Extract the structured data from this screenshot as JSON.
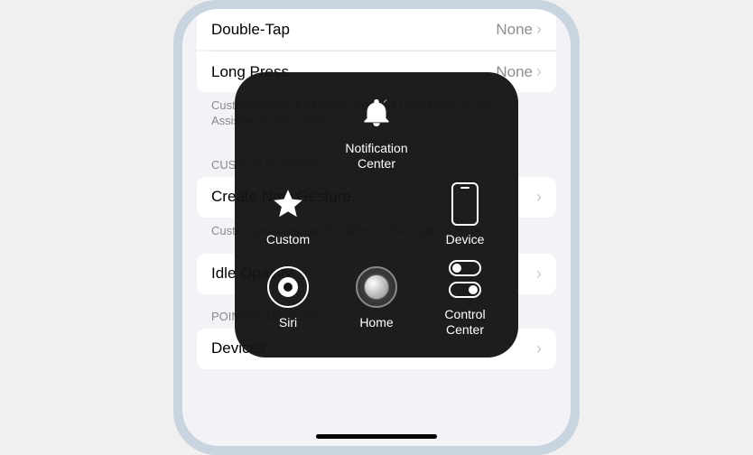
{
  "settings": {
    "gestures": {
      "doubleTap": {
        "label": "Double-Tap",
        "value": "None"
      },
      "longPress": {
        "label": "Long Press",
        "value": "None"
      },
      "description": "Custom actions for Double-Tap and Long Press on the AssistiveTouch button."
    },
    "customActions": {
      "header": "CUSTOM ACTIONS",
      "create": {
        "label": "Create New Gesture..."
      },
      "description": "Custom gestures can be added to the Custom menu.",
      "idle": {
        "label": "Idle Opacity"
      }
    },
    "pointerDevices": {
      "header": "POINTER DEVICES",
      "devices": {
        "label": "Devices"
      }
    }
  },
  "assistiveTouch": {
    "custom": {
      "label": "Custom"
    },
    "notificationCenter": {
      "label": "Notification\nCenter"
    },
    "device": {
      "label": "Device"
    },
    "siri": {
      "label": "Siri"
    },
    "home": {
      "label": "Home"
    },
    "controlCenter": {
      "label": "Control\nCenter"
    }
  }
}
